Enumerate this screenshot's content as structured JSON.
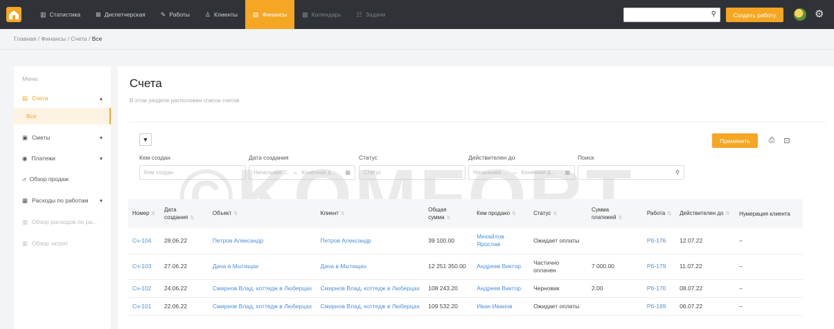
{
  "nav": {
    "items": [
      {
        "label": "Статистика",
        "icon": "bar-chart-icon",
        "glyph": "▥",
        "active": false,
        "dim": false
      },
      {
        "label": "Диспетчерская",
        "icon": "dispatch-icon",
        "glyph": "⊠",
        "active": false,
        "dim": false
      },
      {
        "label": "Работы",
        "icon": "wrench-icon",
        "glyph": "✎",
        "active": false,
        "dim": false
      },
      {
        "label": "Клиенты",
        "icon": "user-icon",
        "glyph": "♙",
        "active": false,
        "dim": false
      },
      {
        "label": "Финансы",
        "icon": "finance-icon",
        "glyph": "▤",
        "active": true,
        "dim": false
      },
      {
        "label": "Календарь",
        "icon": "calendar-icon",
        "glyph": "▦",
        "active": false,
        "dim": true
      },
      {
        "label": "Задачи",
        "icon": "tasks-icon",
        "glyph": "☷",
        "active": false,
        "dim": true
      }
    ],
    "search_placeholder": "",
    "create_label": "Создать работу"
  },
  "breadcrumb": {
    "prefix": "Главная / Финансы / Счета / ",
    "last": "Все"
  },
  "sidebar": {
    "caption": "Меню",
    "items": [
      {
        "label": "Счета",
        "icon": "invoice-icon",
        "glyph": "▤",
        "chevron": "▴",
        "style": "orange"
      },
      {
        "label": "Все",
        "icon": "",
        "glyph": "",
        "chevron": "",
        "style": "sub"
      },
      {
        "label": "Сметы",
        "icon": "estimate-icon",
        "glyph": "▣",
        "chevron": "▾",
        "style": ""
      },
      {
        "label": "Платежи",
        "icon": "payment-icon",
        "glyph": "◉",
        "chevron": "▾",
        "style": ""
      },
      {
        "label": "Обзор продаж",
        "icon": "sales-chart-icon",
        "glyph": "⩘",
        "chevron": "",
        "style": ""
      },
      {
        "label": "Расходы по работам",
        "icon": "expenses-icon",
        "glyph": "▦",
        "chevron": "▾",
        "style": ""
      },
      {
        "label": "Обзор расходов по ра...",
        "icon": "expense-chart-icon",
        "glyph": "▥",
        "chevron": "",
        "style": "faded"
      },
      {
        "label": "Обзор затрат",
        "icon": "costs-chart-icon",
        "glyph": "▥",
        "chevron": "",
        "style": "faded"
      }
    ]
  },
  "page": {
    "title": "Счета",
    "subtitle": "В этом разделе расположен список счетов"
  },
  "filters": {
    "apply_label": "Применить",
    "created_by": {
      "label": "Кем создан",
      "placeholder": "Кем создан"
    },
    "created_date": {
      "label": "Дата создания",
      "start": "Начальная ...",
      "end": "Конечная д..."
    },
    "status": {
      "label": "Статус",
      "placeholder": "Статус"
    },
    "valid_until": {
      "label": "Действителен до",
      "start": "Начальная ...",
      "end": "Конечная д..."
    },
    "search": {
      "label": "Поиск",
      "placeholder": ""
    }
  },
  "watermark": "©KOMFORT",
  "table": {
    "headers": [
      "Номер",
      "Дата создания",
      "Объект",
      "Клиент",
      "Общая сумма",
      "Кем продано",
      "Статус",
      "Сумма платежей",
      "Работа",
      "Действителен до",
      "Нумерация клиента"
    ],
    "rows": [
      [
        "Сч-104",
        "28.06.22",
        "Петров Александр",
        "Петров Александр",
        "39 100.00",
        "Михайлов Ярослав",
        "Ожидает оплаты",
        "",
        "Рб-176",
        "12.07.22",
        "–"
      ],
      [
        "Сч-103",
        "27.06.22",
        "Дача в Мытищах",
        "Дача в Мытищах",
        "12 251 350.00",
        "Андреев Виктор",
        "Частично оплачен",
        "7 000.00",
        "Рб-179",
        "11.07.22",
        "–"
      ],
      [
        "Сч-102",
        "24.06.22",
        "Смирнов Влад, коттедж в Люберцах",
        "Смирнов Влад, коттедж в Люберцах",
        "108 243.20",
        "Андреев Виктор",
        "Черновик",
        "2.00",
        "Рб-170",
        "08.07.22",
        "–"
      ],
      [
        "Сч-101",
        "22.06.22",
        "Смирнов Влад, коттедж в Люберцах",
        "Смирнов Влад, коттедж в Люберцах",
        "109 532.20",
        "Иван Иванов",
        "Ожидает оплаты",
        "",
        "Рб-169",
        "06.07.22",
        "–"
      ]
    ]
  }
}
